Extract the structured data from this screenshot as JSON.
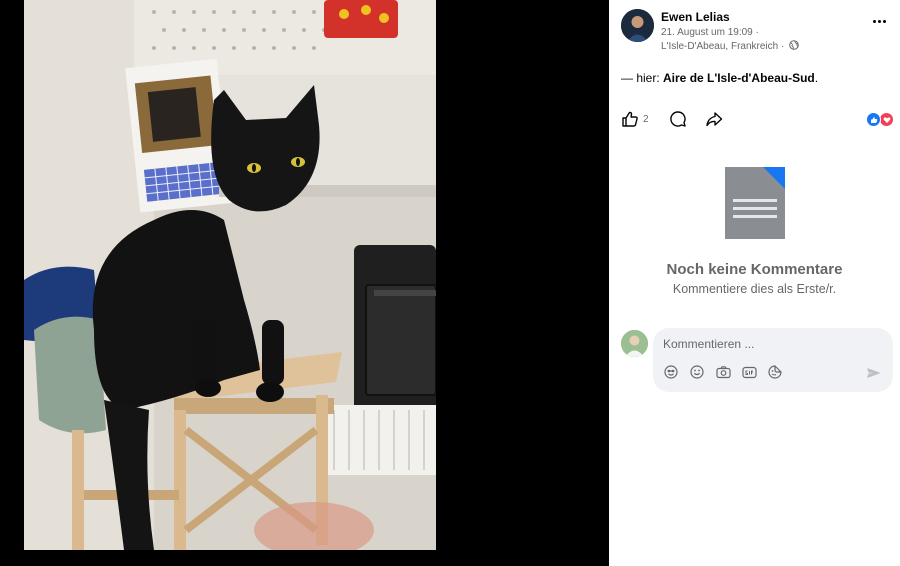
{
  "post": {
    "author": "Ewen Lelias",
    "date": "21. August um 19:09",
    "date_sep": " ·",
    "location": "L'Isle-D'Abeau, Frankreich",
    "location_sep": " ·",
    "privacy_icon": "globe-icon",
    "text_prefix": "— hier: ",
    "text_place": "Aire de L'Isle-d'Abeau-Sud",
    "text_suffix": "."
  },
  "actions": {
    "like_count": "2",
    "like_icon": "thumbs-up-icon",
    "comment_icon": "comment-icon",
    "share_icon": "share-icon",
    "reactions": [
      "like-reaction-icon",
      "love-reaction-icon"
    ]
  },
  "comments": {
    "empty_title": "Noch keine Kommentare",
    "empty_subtitle": "Kommentiere dies als Erste/r.",
    "input_placeholder": "Kommentieren ...",
    "tools": [
      "avatar-sticker-icon",
      "emoji-icon",
      "camera-icon",
      "gif-icon",
      "sticker-icon"
    ]
  },
  "colors": {
    "brand_blue": "#1877f2",
    "love_red": "#f33e58",
    "secondary_text": "#65676b",
    "input_bg": "#f0f2f5"
  }
}
